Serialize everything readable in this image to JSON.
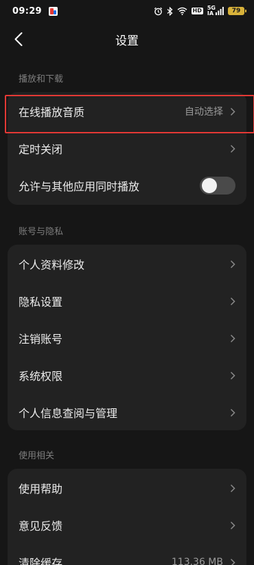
{
  "status_bar": {
    "time": "09:29",
    "hd": "HD",
    "signal_top": "5G",
    "signal_bottom": "IA",
    "battery": "79"
  },
  "header": {
    "title": "设置",
    "back_icon": "chevron-left-icon"
  },
  "sections": {
    "playback": {
      "title": "播放和下载",
      "online_quality": {
        "label": "在线播放音质",
        "value": "自动选择"
      },
      "sleep_timer": {
        "label": "定时关闭"
      },
      "allow_concurrent": {
        "label": "允许与其他应用同时播放",
        "enabled": false
      }
    },
    "account": {
      "title": "账号与隐私",
      "items": [
        {
          "label": "个人资料修改"
        },
        {
          "label": "隐私设置"
        },
        {
          "label": "注销账号"
        },
        {
          "label": "系统权限"
        },
        {
          "label": "个人信息查阅与管理"
        }
      ]
    },
    "usage": {
      "title": "使用相关",
      "help": {
        "label": "使用帮助"
      },
      "feedback": {
        "label": "意见反馈"
      },
      "clear_cache": {
        "label": "清除缓存",
        "value": "113.36 MB"
      }
    }
  },
  "colors": {
    "background": "#161616",
    "card": "#222222",
    "highlight_box": "#e53935",
    "battery": "#d8b23a"
  }
}
